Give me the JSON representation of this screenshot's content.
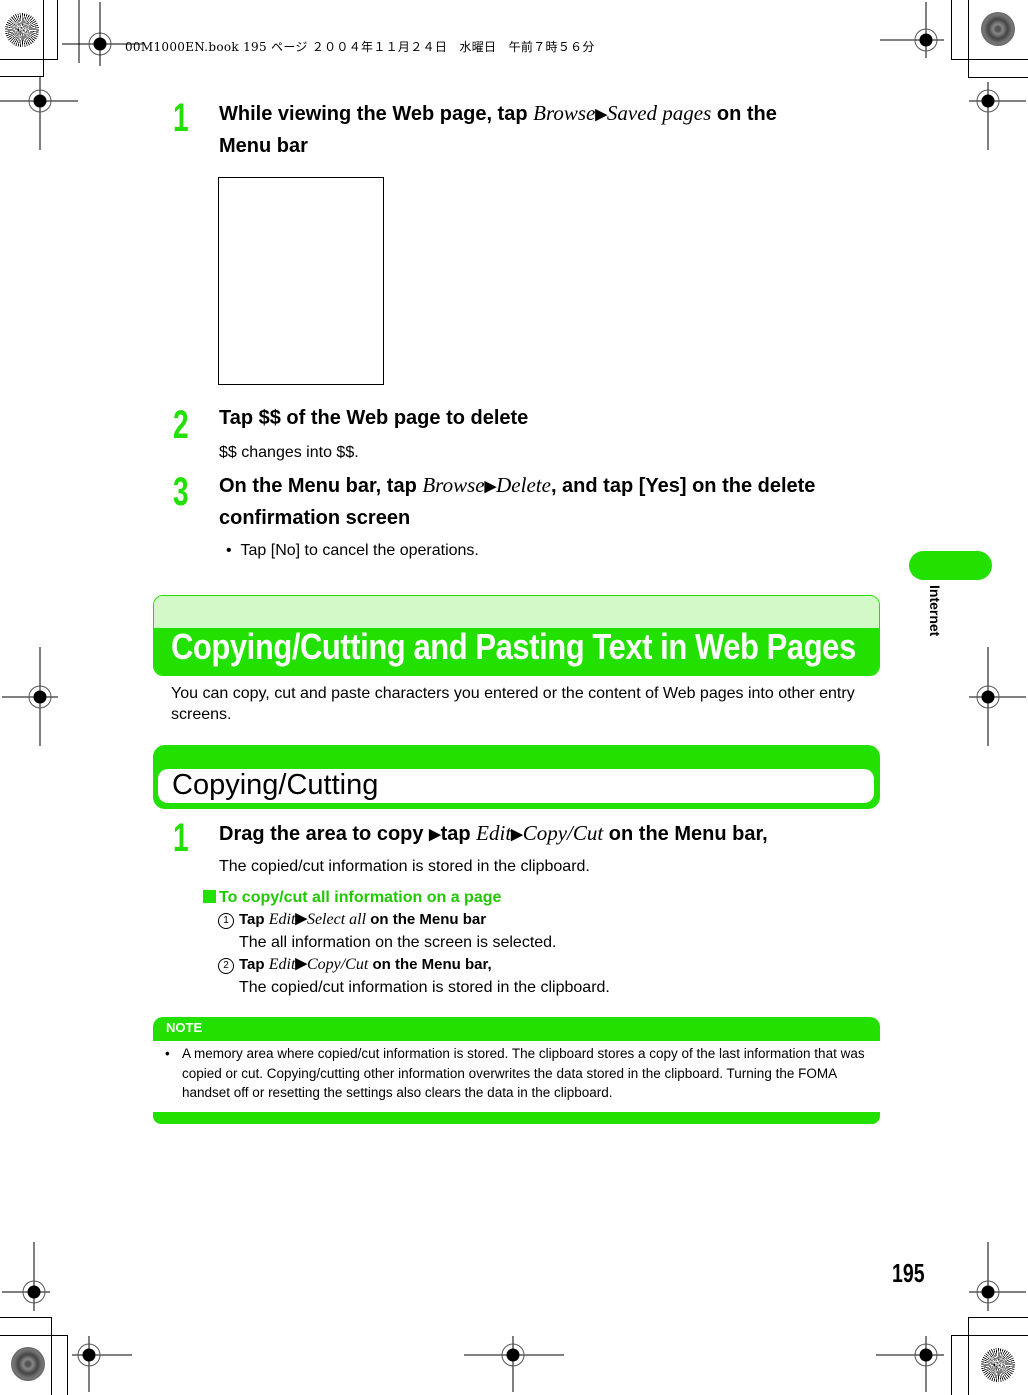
{
  "header_slug": "00M1000EN.book   195 ページ   ２００４年１１月２４日　水曜日　午前７時５６分",
  "side_tab": {
    "label": "Internet",
    "color": "#22e000"
  },
  "page_number": "195",
  "accent_color": "#22e000",
  "steps_top": [
    {
      "number": "1",
      "title_parts": [
        {
          "text": "While viewing the Web page, tap ",
          "style": "bold"
        },
        {
          "text": "Browse",
          "style": "italic"
        },
        {
          "text": " ▶ ",
          "style": "arrow"
        },
        {
          "text": "Saved pages",
          "style": "italic"
        },
        {
          "text": " on the",
          "style": "bold"
        }
      ],
      "title_line2": "Menu bar"
    },
    {
      "number": "2",
      "title": "Tap $$ of the Web page to delete",
      "body": "$$ changes into $$."
    },
    {
      "number": "3",
      "title_parts": [
        {
          "text": "On the Menu bar, tap ",
          "style": "bold"
        },
        {
          "text": "Browse",
          "style": "italic"
        },
        {
          "text": "▶ ",
          "style": "arrow"
        },
        {
          "text": "Delete",
          "style": "italic"
        },
        {
          "text": ", and tap [Yes] on the delete",
          "style": "bold"
        }
      ],
      "title_line2": "confirmation screen",
      "bullet": "Tap [No] to cancel the operations."
    }
  ],
  "section_main": {
    "title": "Copying/Cutting and Pasting Text in Web Pages",
    "intro_line1": "You can copy, cut and paste characters you entered or the content of Web pages into other entry",
    "intro_line2": "screens."
  },
  "section_sub": {
    "title": "Copying/Cutting",
    "step": {
      "number": "1",
      "title_parts": [
        {
          "text": "Drag the area to copy ",
          "style": "bold"
        },
        {
          "text": "▶ ",
          "style": "arrow"
        },
        {
          "text": "tap ",
          "style": "bold"
        },
        {
          "text": "Edit",
          "style": "italic"
        },
        {
          "text": "▶ ",
          "style": "arrow"
        },
        {
          "text": "Copy/Cut",
          "style": "italic"
        },
        {
          "text": " on the Menu bar,",
          "style": "bold"
        }
      ],
      "body": "The copied/cut information is stored in the clipboard."
    },
    "subheading": "To copy/cut all information on a page",
    "substeps": [
      {
        "marker": "1",
        "parts": [
          {
            "text": "Tap ",
            "style": "bold"
          },
          {
            "text": "Edit",
            "style": "italic"
          },
          {
            "text": " ▶ ",
            "style": "arrow"
          },
          {
            "text": "Select all",
            "style": "italic"
          },
          {
            "text": " on the Menu bar",
            "style": "bold"
          }
        ],
        "body": "The all information on the screen is selected."
      },
      {
        "marker": "2",
        "parts": [
          {
            "text": "Tap ",
            "style": "bold"
          },
          {
            "text": "Edit",
            "style": "italic"
          },
          {
            "text": "▶ ",
            "style": "arrow"
          },
          {
            "text": "Copy/Cut",
            "style": "italic"
          },
          {
            "text": " on the Menu bar,",
            "style": "bold"
          }
        ],
        "body": "The copied/cut information is stored in the clipboard."
      }
    ]
  },
  "note": {
    "label": "NOTE",
    "bullet": "•",
    "text": "A memory area where copied/cut information is stored. The clipboard stores a copy of the last information that was copied or cut. Copying/cutting other information overwrites the data stored in the clipboard. Turning the FOMA handset off or resetting the settings also clears the data in the clipboard."
  }
}
